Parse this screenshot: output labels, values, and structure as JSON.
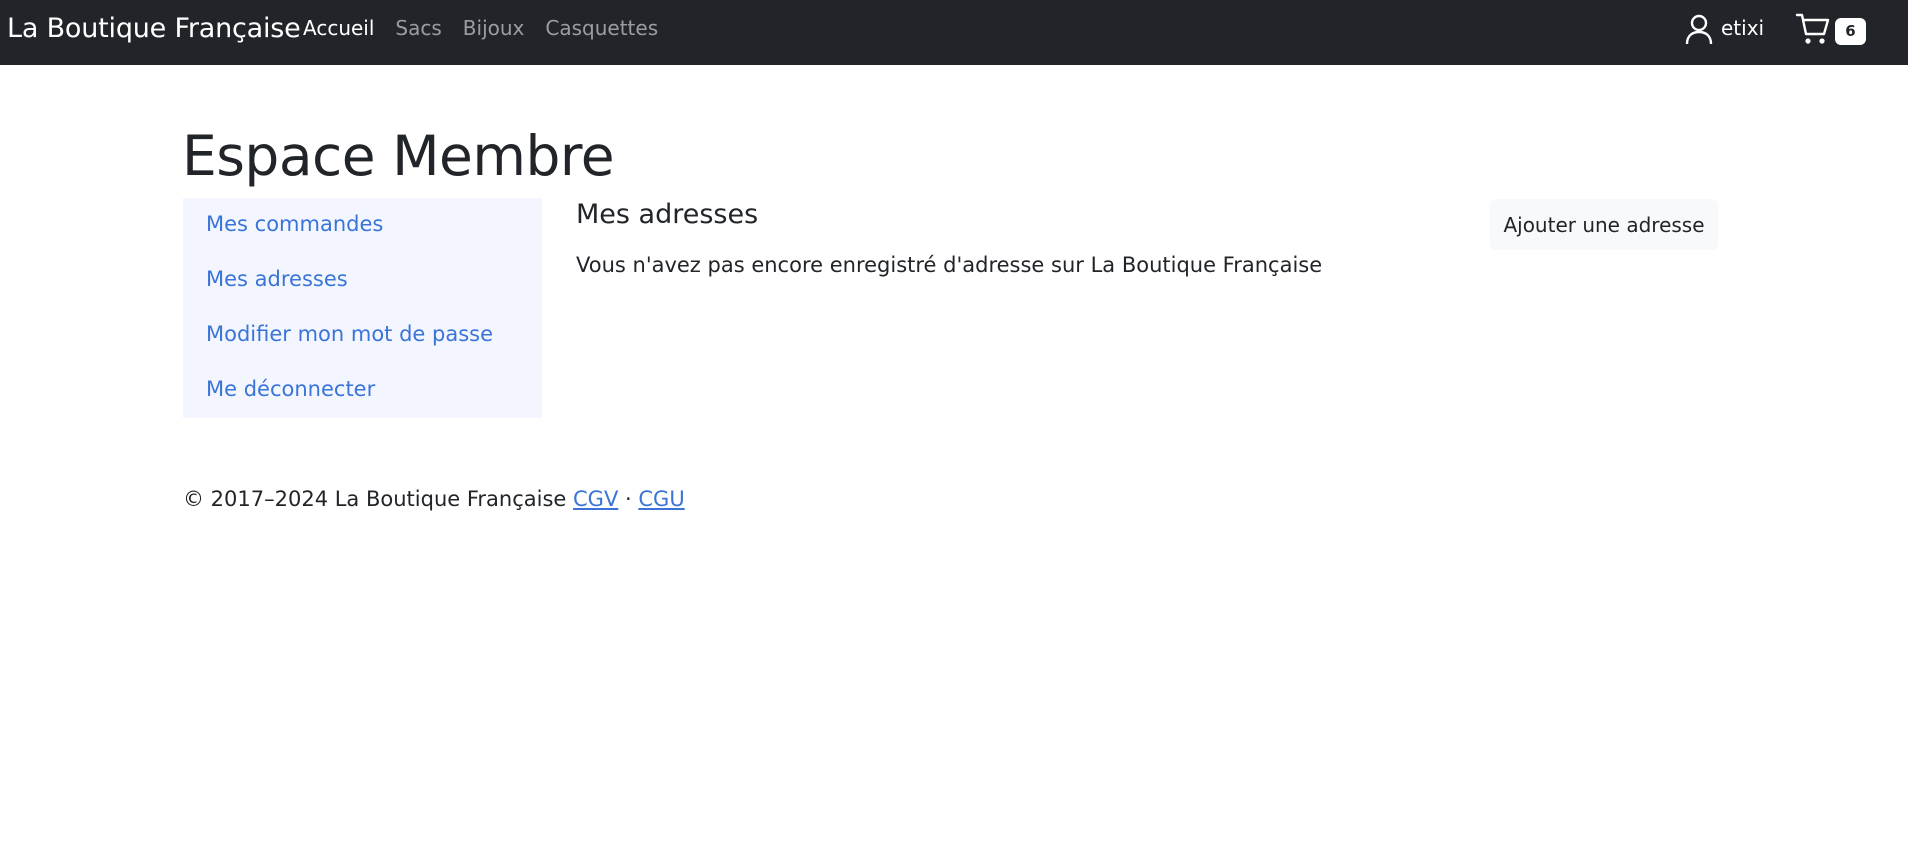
{
  "navbar": {
    "brand": "La Boutique Française",
    "links": [
      {
        "label": "Accueil",
        "active": true
      },
      {
        "label": "Sacs",
        "active": false
      },
      {
        "label": "Bijoux",
        "active": false
      },
      {
        "label": "Casquettes",
        "active": false
      }
    ],
    "user": {
      "icon": "user-icon",
      "name": "etixi"
    },
    "cart": {
      "icon": "cart-icon",
      "count": "6"
    }
  },
  "page": {
    "title": "Espace Membre"
  },
  "sidebar": {
    "items": [
      {
        "label": "Mes commandes"
      },
      {
        "label": "Mes adresses"
      },
      {
        "label": "Modifier mon mot de passe"
      },
      {
        "label": "Me déconnecter"
      }
    ]
  },
  "main": {
    "section_title": "Mes adresses",
    "empty_message": "Vous n'avez pas encore enregistré d'adresse sur La Boutique Française",
    "add_button_label": "Ajouter une adresse"
  },
  "footer": {
    "copyright": "© 2017–2024 La Boutique Française",
    "cgv_label": "CGV",
    "separator": "·",
    "cgu_label": "CGU"
  },
  "colors": {
    "navbar_bg": "#212529",
    "link_blue": "#3a74d8",
    "sidebar_bg": "#f3f6fe"
  }
}
